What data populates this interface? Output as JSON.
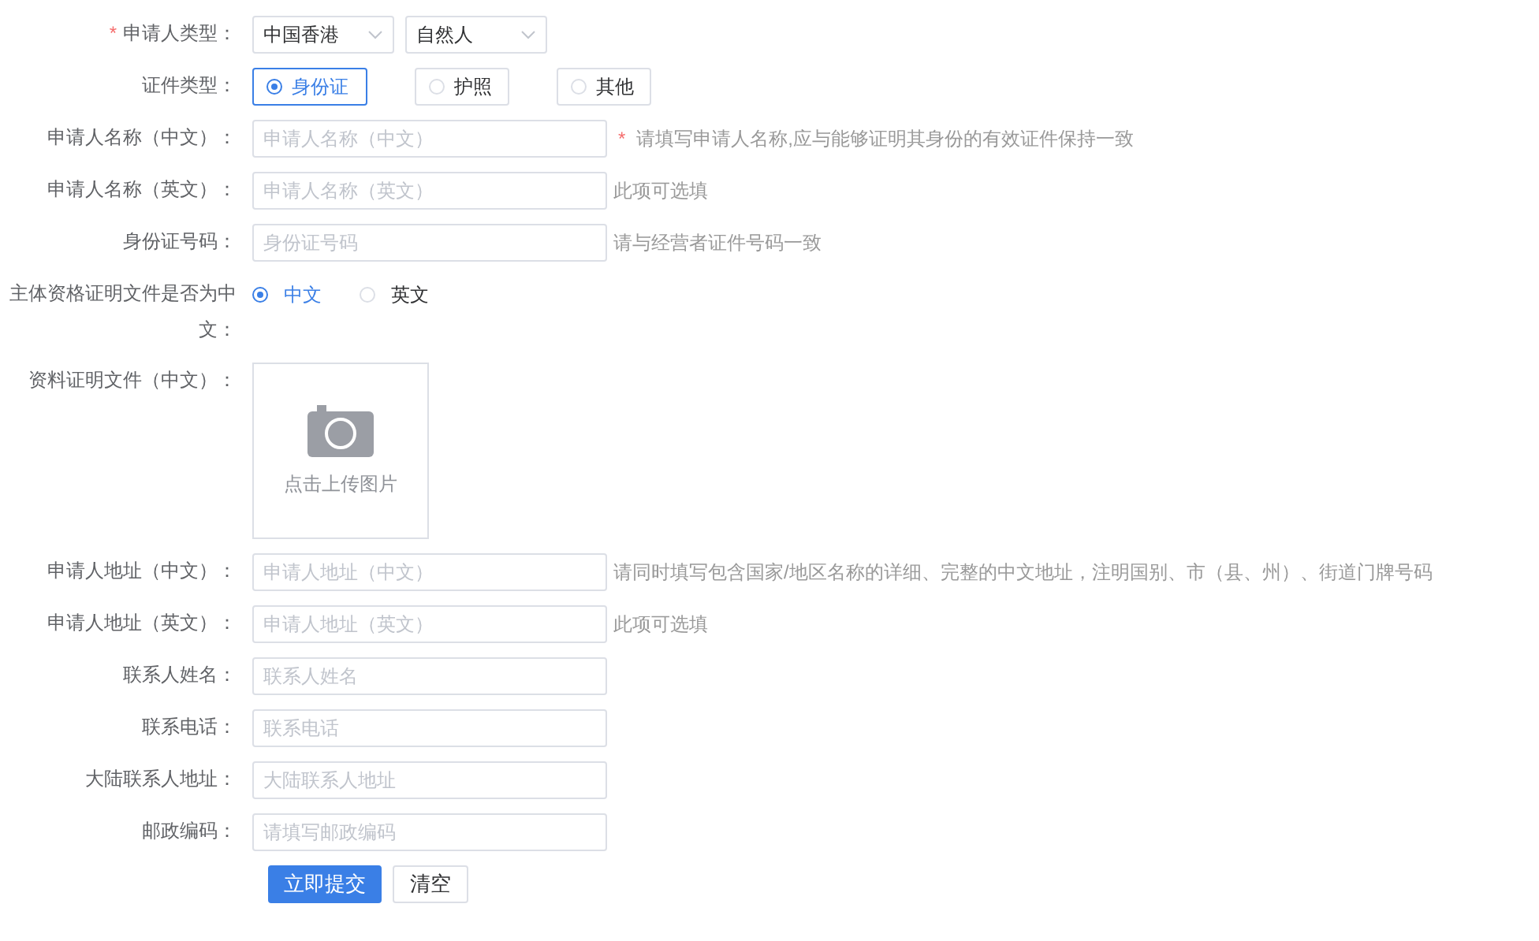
{
  "form": {
    "rows": [
      {
        "kind": "selects",
        "required_mark": "*",
        "label": "申请人类型：",
        "selects": [
          {
            "value": "中国香港"
          },
          {
            "value": "自然人"
          }
        ]
      },
      {
        "kind": "radio-boxes",
        "label": "证件类型：",
        "options": [
          {
            "label": "身份证",
            "selected": true
          },
          {
            "label": "护照",
            "selected": false
          },
          {
            "label": "其他",
            "selected": false
          }
        ]
      },
      {
        "kind": "input",
        "label": "申请人名称（中文）：",
        "placeholder": "申请人名称（中文）",
        "hint_mark": "*",
        "hint": "请填写申请人名称,应与能够证明其身份的有效证件保持一致"
      },
      {
        "kind": "input",
        "label": "申请人名称（英文）：",
        "placeholder": "申请人名称（英文）",
        "hint": "此项可选填"
      },
      {
        "kind": "input",
        "label": "身份证号码：",
        "placeholder": "身份证号码",
        "hint": "请与经营者证件号码一致"
      },
      {
        "kind": "radios",
        "label": "主体资格证明文件是否为中文：",
        "options": [
          {
            "label": "中文",
            "selected": true
          },
          {
            "label": "英文",
            "selected": false
          }
        ]
      },
      {
        "kind": "upload",
        "label": "资料证明文件（中文）：",
        "text": "点击上传图片"
      },
      {
        "kind": "input",
        "label": "申请人地址（中文）：",
        "placeholder": "申请人地址（中文）",
        "hint": "请同时填写包含国家/地区名称的详细、完整的中文地址，注明国别、市（县、州）、街道门牌号码"
      },
      {
        "kind": "input",
        "label": "申请人地址（英文）：",
        "placeholder": "申请人地址（英文）",
        "hint": "此项可选填"
      },
      {
        "kind": "input",
        "label": "联系人姓名：",
        "placeholder": "联系人姓名"
      },
      {
        "kind": "input",
        "label": "联系电话：",
        "placeholder": "联系电话"
      },
      {
        "kind": "input",
        "label": "大陆联系人地址：",
        "placeholder": "大陆联系人地址"
      },
      {
        "kind": "input",
        "label": "邮政编码：",
        "placeholder": "请填写邮政编码"
      }
    ],
    "buttons": [
      {
        "kind": "primary",
        "label": "立即提交"
      },
      {
        "kind": "default",
        "label": "清空"
      }
    ]
  }
}
